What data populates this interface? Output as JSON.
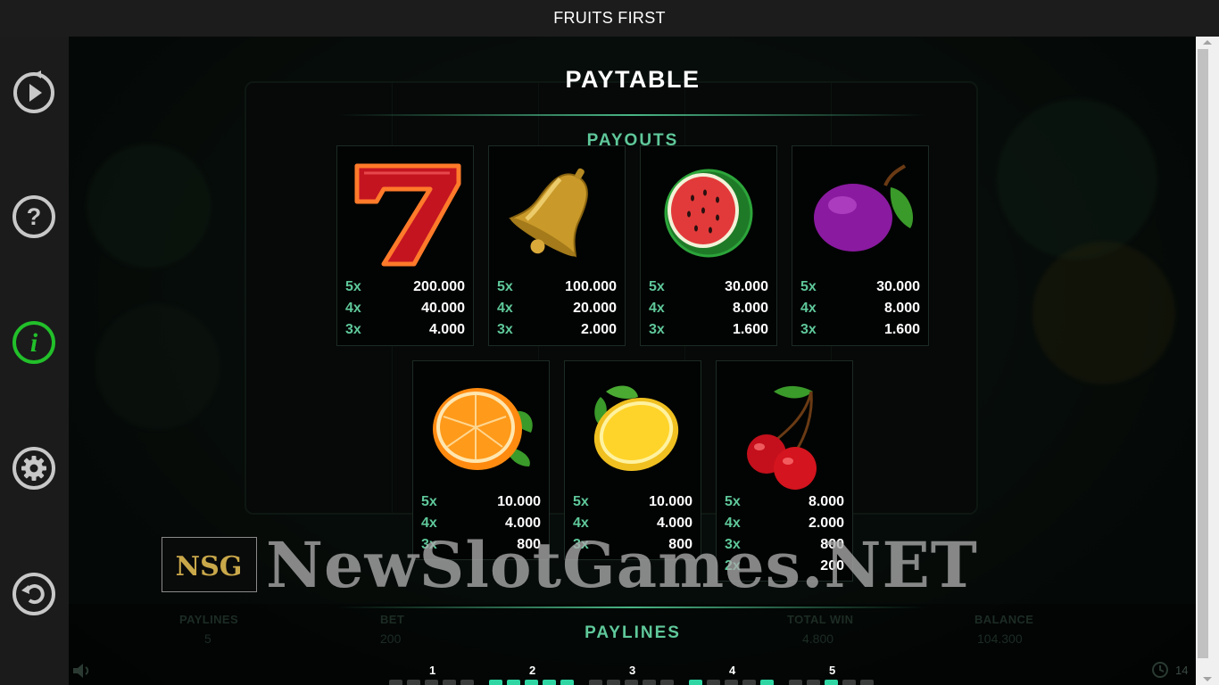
{
  "app": {
    "title": "FRUITS FIRST"
  },
  "sidebar": {
    "items": [
      {
        "name": "autoplay",
        "icon": "autoplay-icon"
      },
      {
        "name": "help",
        "icon": "help-icon"
      },
      {
        "name": "info",
        "icon": "info-icon",
        "active": true
      },
      {
        "name": "settings",
        "icon": "gear-icon"
      },
      {
        "name": "back",
        "icon": "back-icon"
      }
    ],
    "colors": {
      "icon": "#c8c8c8",
      "active": "#22c02a"
    }
  },
  "paytable": {
    "title": "PAYTABLE",
    "payouts_title": "PAYOUTS",
    "paylines_title": "PAYLINES",
    "symbols": [
      {
        "symbol": "seven-icon",
        "rows": [
          {
            "count": "5x",
            "amount": "200.000"
          },
          {
            "count": "4x",
            "amount": "40.000"
          },
          {
            "count": "3x",
            "amount": "4.000"
          }
        ]
      },
      {
        "symbol": "bell-icon",
        "rows": [
          {
            "count": "5x",
            "amount": "100.000"
          },
          {
            "count": "4x",
            "amount": "20.000"
          },
          {
            "count": "3x",
            "amount": "2.000"
          }
        ]
      },
      {
        "symbol": "watermelon-icon",
        "rows": [
          {
            "count": "5x",
            "amount": "30.000"
          },
          {
            "count": "4x",
            "amount": "8.000"
          },
          {
            "count": "3x",
            "amount": "1.600"
          }
        ]
      },
      {
        "symbol": "plum-icon",
        "rows": [
          {
            "count": "5x",
            "amount": "30.000"
          },
          {
            "count": "4x",
            "amount": "8.000"
          },
          {
            "count": "3x",
            "amount": "1.600"
          }
        ]
      },
      {
        "symbol": "orange-icon",
        "rows": [
          {
            "count": "5x",
            "amount": "10.000"
          },
          {
            "count": "4x",
            "amount": "4.000"
          },
          {
            "count": "3x",
            "amount": "800"
          }
        ]
      },
      {
        "symbol": "lemon-icon",
        "rows": [
          {
            "count": "5x",
            "amount": "10.000"
          },
          {
            "count": "4x",
            "amount": "4.000"
          },
          {
            "count": "3x",
            "amount": "800"
          }
        ]
      },
      {
        "symbol": "cherry-icon",
        "rows": [
          {
            "count": "5x",
            "amount": "8.000"
          },
          {
            "count": "4x",
            "amount": "2.000"
          },
          {
            "count": "3x",
            "amount": "800"
          },
          {
            "count": "2x",
            "amount": "200"
          }
        ]
      }
    ],
    "paylines": [
      {
        "number": "1"
      },
      {
        "number": "2"
      },
      {
        "number": "3"
      },
      {
        "number": "4"
      },
      {
        "number": "5"
      }
    ],
    "colors": {
      "accent": "#5fc89a",
      "cell_on": "#2fd6a3",
      "cell_off": "#3a3d3c"
    }
  },
  "background_bar": {
    "paylines_label": "PAYLINES",
    "paylines_value": "5",
    "bet_label": "BET",
    "bet_value": "200",
    "total_win_label": "TOTAL WIN",
    "total_win_value": "4.800",
    "balance_label": "BALANCE",
    "balance_value": "104.300",
    "clock_text": "14"
  },
  "watermark": {
    "logo_text": "NSG",
    "text": "NewSlotGames.NET"
  }
}
